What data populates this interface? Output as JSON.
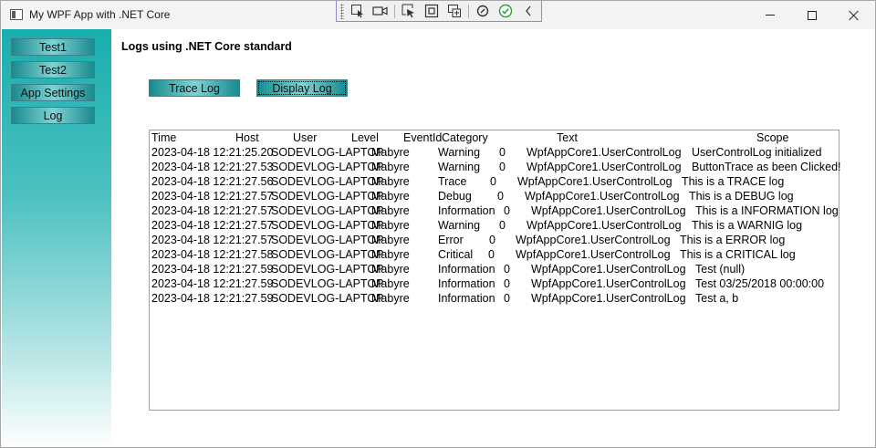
{
  "window": {
    "title": "My WPF App with .NET Core"
  },
  "colors": {
    "accent_teal": "#19aeae",
    "button_teal_dark": "#1a8a8e",
    "button_teal_light": "#7fd3d3",
    "titlebar_bg": "#f3f3f3"
  },
  "debug_toolbar": {
    "icons": [
      "select-element-icon",
      "record-icon",
      "select-cursor-icon",
      "display-layout-adorner-icon",
      "track-focus-icon",
      "hot-reload-icon",
      "binding-check-icon",
      "collapse-chevron-icon"
    ]
  },
  "sidebar": {
    "items": [
      {
        "label": "Test1"
      },
      {
        "label": "Test2"
      },
      {
        "label": "App Settings"
      },
      {
        "label": "Log"
      }
    ]
  },
  "main": {
    "title": "Logs using .NET Core standard",
    "trace_button": "Trace Log",
    "display_button": "Display Log"
  },
  "log": {
    "columns": {
      "time": "Time",
      "host": "Host",
      "user": "User",
      "level": "Level",
      "eventid": "EventId",
      "category": "Category",
      "text": "Text",
      "scope": "Scope"
    },
    "rows": [
      {
        "time": "2023-04-18 12:21:25.20",
        "host": "SODEVLOG-LAPTOP",
        "user": "Mabyre",
        "level": "Warning",
        "eventid": "0",
        "category": "WpfAppCore1.UserControlLog",
        "text": "UserControlLog initialized"
      },
      {
        "time": "2023-04-18 12:21:27.53",
        "host": "SODEVLOG-LAPTOP",
        "user": "Mabyre",
        "level": "Warning",
        "eventid": "0",
        "category": "WpfAppCore1.UserControlLog",
        "text": "ButtonTrace as been Clicked!"
      },
      {
        "time": "2023-04-18 12:21:27.56",
        "host": "SODEVLOG-LAPTOP",
        "user": "Mabyre",
        "level": "Trace",
        "eventid": "0",
        "category": "WpfAppCore1.UserControlLog",
        "text": "This is a TRACE log"
      },
      {
        "time": "2023-04-18 12:21:27.57",
        "host": "SODEVLOG-LAPTOP",
        "user": "Mabyre",
        "level": "Debug",
        "eventid": "0",
        "category": "WpfAppCore1.UserControlLog",
        "text": "This is a DEBUG log"
      },
      {
        "time": "2023-04-18 12:21:27.57",
        "host": "SODEVLOG-LAPTOP",
        "user": "Mabyre",
        "level": "Information",
        "eventid": "0",
        "category": "WpfAppCore1.UserControlLog",
        "text": "This is a INFORMATION log"
      },
      {
        "time": "2023-04-18 12:21:27.57",
        "host": "SODEVLOG-LAPTOP",
        "user": "Mabyre",
        "level": "Warning",
        "eventid": "0",
        "category": "WpfAppCore1.UserControlLog",
        "text": "This is a WARNIG log"
      },
      {
        "time": "2023-04-18 12:21:27.57",
        "host": "SODEVLOG-LAPTOP",
        "user": "Mabyre",
        "level": "Error",
        "eventid": "0",
        "category": "WpfAppCore1.UserControlLog",
        "text": "This is a ERROR log"
      },
      {
        "time": "2023-04-18 12:21:27.58",
        "host": "SODEVLOG-LAPTOP",
        "user": "Mabyre",
        "level": "Critical",
        "eventid": "0",
        "category": "WpfAppCore1.UserControlLog",
        "text": "This is a CRITICAL log"
      },
      {
        "time": "2023-04-18 12:21:27.59",
        "host": "SODEVLOG-LAPTOP",
        "user": "Mabyre",
        "level": "Information",
        "eventid": "0",
        "category": "WpfAppCore1.UserControlLog",
        "text": "Test (null)"
      },
      {
        "time": "2023-04-18 12:21:27.59",
        "host": "SODEVLOG-LAPTOP",
        "user": "Mabyre",
        "level": "Information",
        "eventid": "0",
        "category": "WpfAppCore1.UserControlLog",
        "text": "Test 03/25/2018 00:00:00"
      },
      {
        "time": "2023-04-18 12:21:27.59",
        "host": "SODEVLOG-LAPTOP",
        "user": "Mabyre",
        "level": "Information",
        "eventid": "0",
        "category": "WpfAppCore1.UserControlLog",
        "text": "Test a, b"
      }
    ]
  }
}
